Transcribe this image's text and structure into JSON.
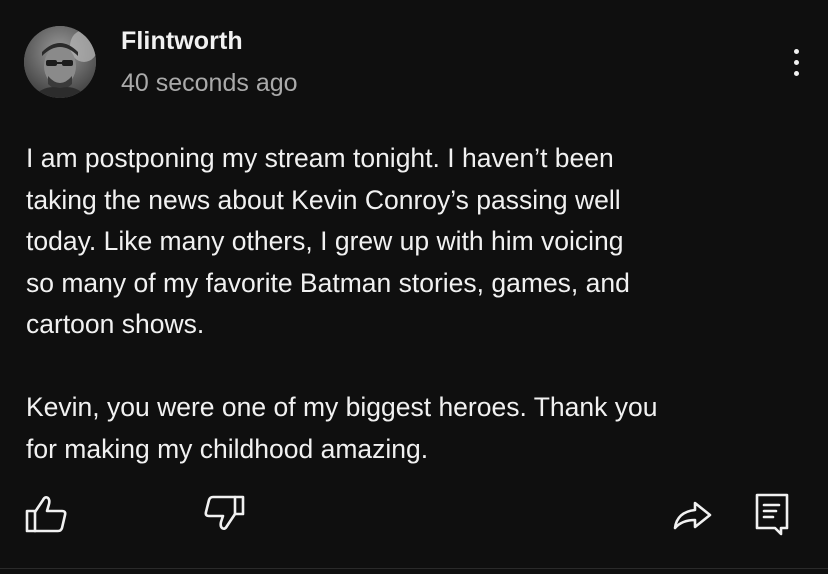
{
  "post": {
    "author": "Flintworth",
    "timestamp": "40 seconds ago",
    "paragraphs": [
      "I am postponing my stream tonight. I haven’t been\ntaking the news about Kevin Conroy’s passing well\ntoday. Like many others, I grew up with him voicing\nso many of my favorite Batman stories, games, and\ncartoon shows.",
      "Kevin, you were one of my biggest heroes. Thank you\nfor making my childhood amazing."
    ]
  },
  "icons": {
    "avatar": "avatar-photo",
    "menu": "more-vertical-icon",
    "like": "thumbs-up-icon",
    "dislike": "thumbs-down-icon",
    "share": "share-arrow-icon",
    "comment": "comment-icon"
  },
  "colors": {
    "background": "#0f0f0f",
    "text_primary": "#f1f1f1",
    "text_secondary": "#aaaaaa"
  }
}
